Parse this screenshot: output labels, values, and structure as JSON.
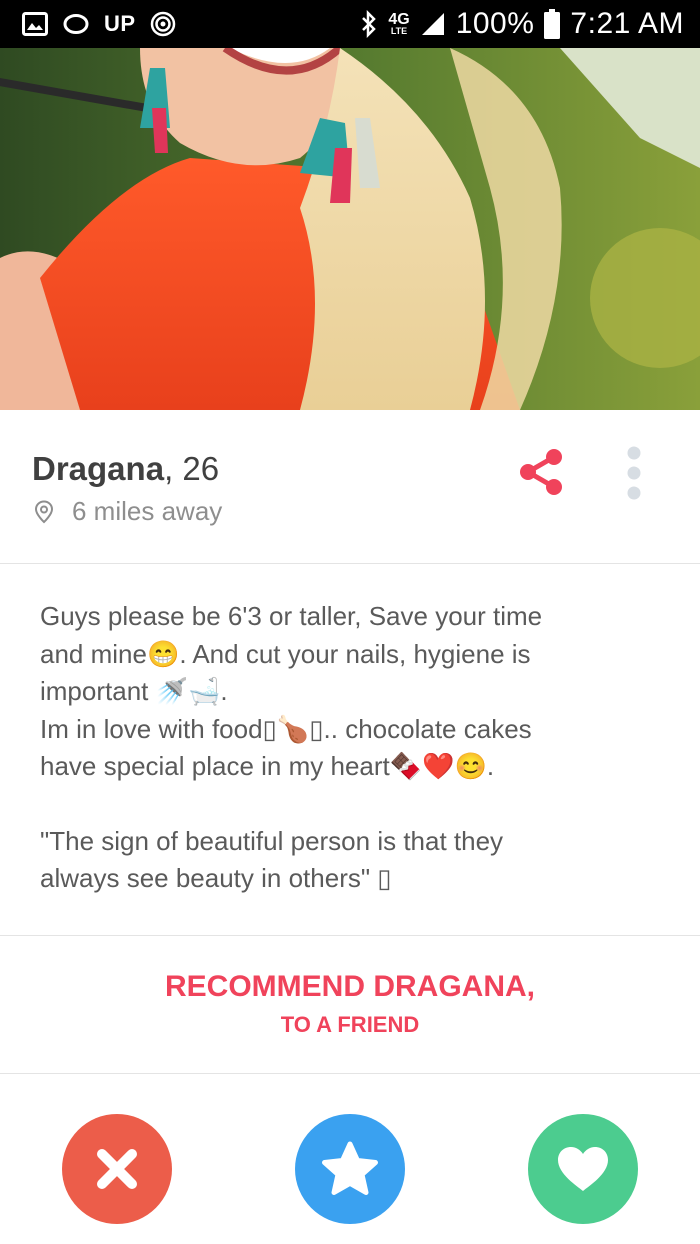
{
  "status_bar": {
    "left_label": "UP",
    "network": "4G",
    "network_sub": "LTE",
    "battery": "100%",
    "time": "7:21 AM"
  },
  "profile": {
    "name": "Dragana",
    "age": "26",
    "distance": "6 miles away"
  },
  "bio": {
    "lines": [
      "Guys please be 6'3 or taller, Save your time",
      "and mine😁. And cut your nails, hygiene is",
      "important 🚿🛁.",
      "Im in love with food▯🍗▯.. chocolate cakes",
      "have special place in my heart🍫❤️😊."
    ],
    "quote_lines": [
      "\"The sign of beautiful person is that they",
      "always see beauty in others\" ▯"
    ]
  },
  "recommend": {
    "line1": "RECOMMEND DRAGANA,",
    "line2": "TO A FRIEND"
  },
  "colors": {
    "accent": "#f0435b",
    "nope": "#ec5d4a",
    "super_like": "#3aa1f0",
    "like": "#4ccc8f",
    "text_primary": "#404040",
    "text_secondary": "#8e8e8e"
  },
  "icons": {
    "status_left": [
      "gallery-icon",
      "circle-icon",
      "up-logo",
      "target-icon"
    ],
    "status_right": [
      "bluetooth-icon",
      "signal-icon",
      "battery-icon"
    ],
    "location": "pin-icon",
    "share": "share-icon",
    "more": "more-vertical-icon",
    "actions": [
      "close-icon",
      "star-icon",
      "heart-icon"
    ]
  }
}
